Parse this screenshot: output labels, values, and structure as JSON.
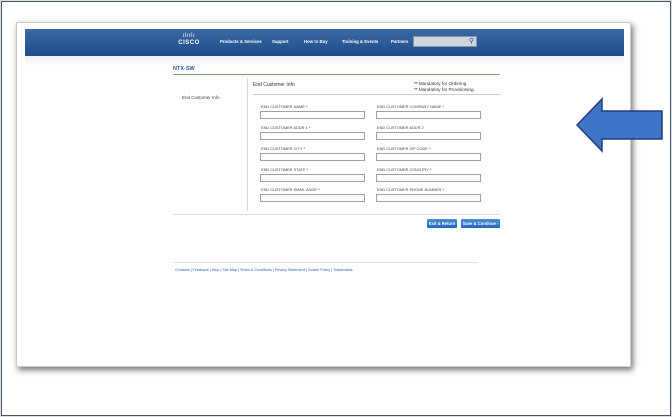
{
  "header": {
    "logo_bars": "ılıılı",
    "logo_text": "CISCO",
    "nav": [
      "Products & Services",
      "Support",
      "How to Buy",
      "Training & Events",
      "Partners"
    ],
    "search_icon": "search-icon"
  },
  "page": {
    "title": "NTX-SW",
    "sidebar_label": "End Customer Info",
    "section_title": "End Customer Info",
    "legend": {
      "ordering": "Mandatory for Ordering.",
      "provisioning": "Mandatory for Provisioning.",
      "ordering_marker": "**",
      "provisioning_marker": "**"
    }
  },
  "fields": [
    {
      "label": "END CUSTOMER NAME",
      "required": "*",
      "value": ""
    },
    {
      "label": "END CUSTOMER COMPANY NAME",
      "required": "*",
      "value": ""
    },
    {
      "label": "END CUSTOMER ADDR 1",
      "required": "*",
      "value": ""
    },
    {
      "label": "END CUSTOMER ADDR 2",
      "required": "",
      "value": ""
    },
    {
      "label": "END CUSTOMER CITY",
      "required": "*",
      "value": ""
    },
    {
      "label": "END CUSTOMER ZIP CODE",
      "required": "*",
      "value": ""
    },
    {
      "label": "END CUSTOMER STATE",
      "required": "*",
      "value": ""
    },
    {
      "label": "END CUSTOMER COUNTRY",
      "required": "*",
      "value": ""
    },
    {
      "label": "END CUSTOMER EMAIL ADDR",
      "required": "*",
      "value": ""
    },
    {
      "label": "END CUSTOMER PHONE NUMBER",
      "required": "*",
      "value": ""
    }
  ],
  "buttons": {
    "exit_return": "Exit & Return",
    "save_continue": "Save & Continue ›"
  },
  "footer": "Contacts  |  Feedback  |  Help  |  Site Map  |  Terms & Conditions  |  Privacy Statement  |  Cookie Policy  |  Trademarks",
  "colors": {
    "header_blue": "#1f4c8a",
    "button_blue": "#2466b8",
    "arrow_blue": "#3f74c9",
    "required_blue": "#2a62b0",
    "ordering_red": "#c0392b"
  }
}
